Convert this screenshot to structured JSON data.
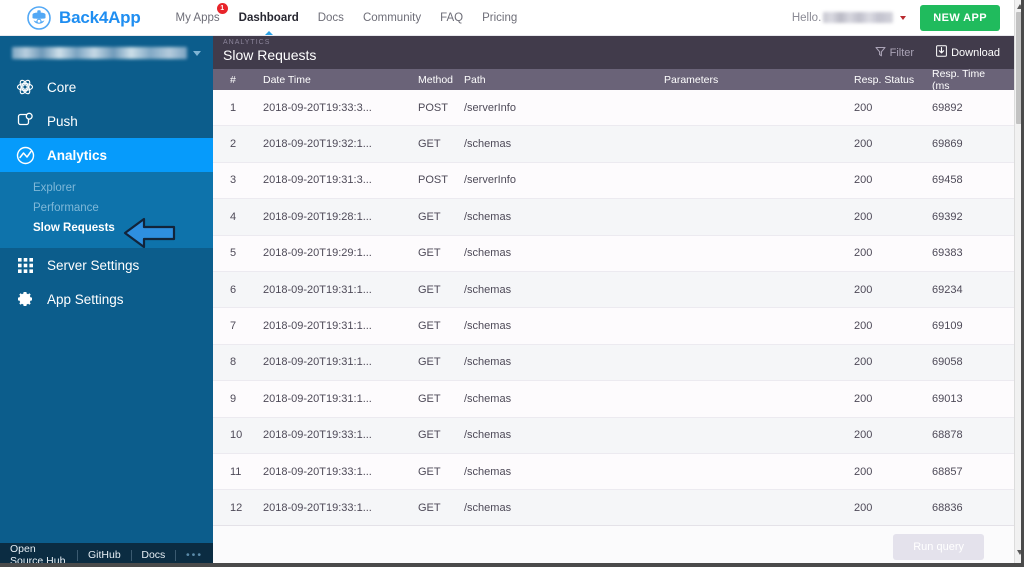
{
  "topnav": {
    "brand": "Back4App",
    "brand_icon": "back4app-mask-logo-icon",
    "menu": [
      {
        "label": "My Apps",
        "active": false,
        "badge": "1"
      },
      {
        "label": "Dashboard",
        "active": true
      },
      {
        "label": "Docs",
        "active": false
      },
      {
        "label": "Community",
        "active": false
      },
      {
        "label": "FAQ",
        "active": false
      },
      {
        "label": "Pricing",
        "active": false
      }
    ],
    "hello_label": "Hello.",
    "username": "",
    "new_app_label": "NEW APP"
  },
  "sidebar": {
    "app_name": "",
    "items": [
      {
        "label": "Core",
        "icon": "atom-icon",
        "selected": false
      },
      {
        "label": "Push",
        "icon": "push-notification-icon",
        "selected": false
      },
      {
        "label": "Analytics",
        "icon": "analytics-wave-icon",
        "selected": true
      }
    ],
    "analytics_subitems": [
      {
        "label": "Explorer",
        "active": false
      },
      {
        "label": "Performance",
        "active": false
      },
      {
        "label": "Slow Requests",
        "active": true
      }
    ],
    "bottom_items": [
      {
        "label": "Server Settings",
        "icon": "grid-apps-icon"
      },
      {
        "label": "App Settings",
        "icon": "gear-icon"
      }
    ],
    "footer": {
      "links": [
        "Open Source Hub",
        "GitHub",
        "Docs"
      ],
      "more": "•••"
    }
  },
  "page": {
    "breadcrumb": "ANALYTICS",
    "title": "Slow Requests",
    "filter_label": "Filter",
    "download_label": "Download",
    "run_query_label": "Run query"
  },
  "table": {
    "columns": [
      "#",
      "Date Time",
      "Method",
      "Path",
      "Parameters",
      "Resp. Status",
      "Resp. Time (ms"
    ],
    "rows": [
      {
        "num": "1",
        "date": "2018-09-20T19:33:3...",
        "method": "POST",
        "path": "/serverInfo",
        "params": "",
        "status": "200",
        "time": "69892"
      },
      {
        "num": "2",
        "date": "2018-09-20T19:32:1...",
        "method": "GET",
        "path": "/schemas",
        "params": "",
        "status": "200",
        "time": "69869"
      },
      {
        "num": "3",
        "date": "2018-09-20T19:31:3...",
        "method": "POST",
        "path": "/serverInfo",
        "params": "",
        "status": "200",
        "time": "69458"
      },
      {
        "num": "4",
        "date": "2018-09-20T19:28:1...",
        "method": "GET",
        "path": "/schemas",
        "params": "",
        "status": "200",
        "time": "69392"
      },
      {
        "num": "5",
        "date": "2018-09-20T19:29:1...",
        "method": "GET",
        "path": "/schemas",
        "params": "",
        "status": "200",
        "time": "69383"
      },
      {
        "num": "6",
        "date": "2018-09-20T19:31:1...",
        "method": "GET",
        "path": "/schemas",
        "params": "",
        "status": "200",
        "time": "69234"
      },
      {
        "num": "7",
        "date": "2018-09-20T19:31:1...",
        "method": "GET",
        "path": "/schemas",
        "params": "",
        "status": "200",
        "time": "69109"
      },
      {
        "num": "8",
        "date": "2018-09-20T19:31:1...",
        "method": "GET",
        "path": "/schemas",
        "params": "",
        "status": "200",
        "time": "69058"
      },
      {
        "num": "9",
        "date": "2018-09-20T19:31:1...",
        "method": "GET",
        "path": "/schemas",
        "params": "",
        "status": "200",
        "time": "69013"
      },
      {
        "num": "10",
        "date": "2018-09-20T19:33:1...",
        "method": "GET",
        "path": "/schemas",
        "params": "",
        "status": "200",
        "time": "68878"
      },
      {
        "num": "11",
        "date": "2018-09-20T19:33:1...",
        "method": "GET",
        "path": "/schemas",
        "params": "",
        "status": "200",
        "time": "68857"
      },
      {
        "num": "12",
        "date": "2018-09-20T19:33:1...",
        "method": "GET",
        "path": "/schemas",
        "params": "",
        "status": "200",
        "time": "68836"
      }
    ]
  },
  "colors": {
    "brand_blue": "#1f8ef1",
    "sidebar_blue": "#0c5d8c",
    "sidebar_selected": "#069bfb",
    "header_purple": "#413b4b",
    "table_header": "#6a6378",
    "new_app_green": "#20bb5d",
    "badge_red": "#e8242a",
    "arrow_blue": "#2e8fe0"
  }
}
